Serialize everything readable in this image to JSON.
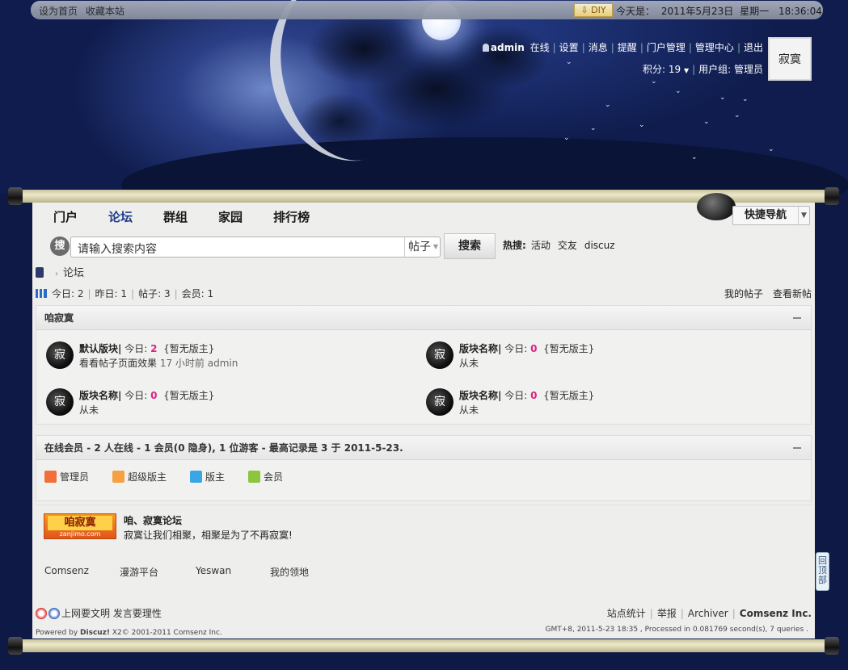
{
  "topbar": {
    "links": [
      "设为首页",
      "收藏本站"
    ],
    "diy_label": "DIY",
    "date_label": "今天是：",
    "date": "2011年5月23日",
    "weekday": "星期一",
    "time": "18:36:04"
  },
  "userbar": {
    "username": "admin",
    "status": "在线",
    "links": [
      "设置",
      "消息",
      "提醒",
      "门户管理",
      "管理中心",
      "退出"
    ],
    "points_label": "积分: 19",
    "usergroup_label": "用户组: 管理员"
  },
  "avatar": {
    "text": "寂寞"
  },
  "nav": {
    "items": [
      "门户",
      "论坛",
      "群组",
      "家园",
      "排行榜"
    ],
    "active_index": 1,
    "quicknav_label": "快捷导航"
  },
  "search": {
    "icon_text": "搜",
    "placeholder": "请输入搜索内容",
    "type": "帖子",
    "button": "搜索",
    "hot_label": "热搜:",
    "hot_tags": [
      "活动",
      "交友",
      "discuz"
    ]
  },
  "breadcrumb": {
    "current": "论坛"
  },
  "stats": {
    "items": [
      "今日: 2",
      "昨日: 1",
      "帖子: 3",
      "会员: 1"
    ],
    "links": [
      "我的帖子",
      "查看新帖"
    ]
  },
  "category": {
    "title": "咱寂寞",
    "forums": [
      {
        "icon": "寂",
        "name": "默认版块",
        "today_label": "今日:",
        "today": "2",
        "mod": "{暂无版主}",
        "last_title": "看看帖子页面效果",
        "last_meta": "17 小时前 admin"
      },
      {
        "icon": "寂",
        "name": "版块名称",
        "today_label": "今日:",
        "today": "0",
        "mod": "{暂无版主}",
        "last_title": "从未",
        "last_meta": ""
      },
      {
        "icon": "寂",
        "name": "版块名称",
        "today_label": "今日:",
        "today": "0",
        "mod": "{暂无版主}",
        "last_title": "从未",
        "last_meta": ""
      },
      {
        "icon": "寂",
        "name": "版块名称",
        "today_label": "今日:",
        "today": "0",
        "mod": "{暂无版主}",
        "last_title": "从未",
        "last_meta": ""
      }
    ]
  },
  "online": {
    "title": "在线会员",
    "summary": " - 2 人在线 - 1 会员(0 隐身), 1 位游客 - 最高记录是 3 于 2011-5-23.",
    "legend": [
      {
        "label": "管理员",
        "color": "#f06f3a"
      },
      {
        "label": "超级版主",
        "color": "#f5a142"
      },
      {
        "label": "版主",
        "color": "#3aa6e6"
      },
      {
        "label": "会员",
        "color": "#8cc63f"
      }
    ]
  },
  "links": {
    "logo_text": "咱寂寞",
    "logo_url": "zanjimo.com",
    "title": "咱、寂寞论坛",
    "desc": "寂寞让我们相聚，相聚是为了不再寂寞!",
    "text_links": [
      "Comsenz",
      "漫游平台",
      "Yeswan",
      "我的领地"
    ]
  },
  "footer": {
    "slogan": "上网要文明 发言要理性",
    "powered_prefix": "Powered by ",
    "powered_name": "Discuz!",
    "powered_suffix": " X2© 2001-2011 Comsenz Inc.",
    "links": [
      "站点统计",
      "举报",
      "Archiver"
    ],
    "company": "Comsenz Inc.",
    "gmt": "GMT+8, 2011-5-23 18:35 , Processed in 0.081769 second(s), 7 queries ."
  },
  "backtop": {
    "label": "回顶部"
  }
}
